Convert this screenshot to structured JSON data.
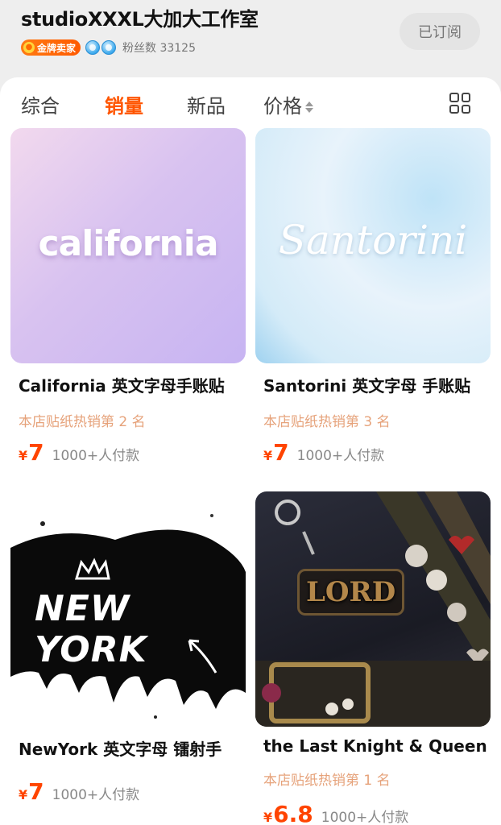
{
  "shop": {
    "name": "studioXXXL大加大工作室",
    "gold_badge": "金牌卖家",
    "fans": "粉丝数 33125",
    "subscribe_label": "已订阅"
  },
  "filters": {
    "tabs": [
      "综合",
      "销量",
      "新品",
      "价格"
    ],
    "active": "销量"
  },
  "products": [
    {
      "image_text": "california",
      "title": "California 英文字母手账贴",
      "rank": "本店贴纸热销第 2 名",
      "currency": "¥",
      "price": "7",
      "sales": "1000+人付款"
    },
    {
      "image_text": "Santorini",
      "title": "Santorini 英文字母 手账贴",
      "rank": "本店贴纸热销第 3 名",
      "currency": "¥",
      "price": "7",
      "sales": "1000+人付款"
    },
    {
      "image_text": "NEW YORK",
      "title": "NewYork 英文字母 镭射手",
      "rank": "",
      "currency": "¥",
      "price": "7",
      "sales": "1000+人付款"
    },
    {
      "image_text": "LORD",
      "title": "the Last Knight & Queen",
      "rank": "本店贴纸热销第 1 名",
      "currency": "¥",
      "price": "6.8",
      "sales": "1000+人付款"
    }
  ],
  "colors": {
    "accent": "#ff5500",
    "price": "#ff4400",
    "rank": "#e6a27a"
  }
}
